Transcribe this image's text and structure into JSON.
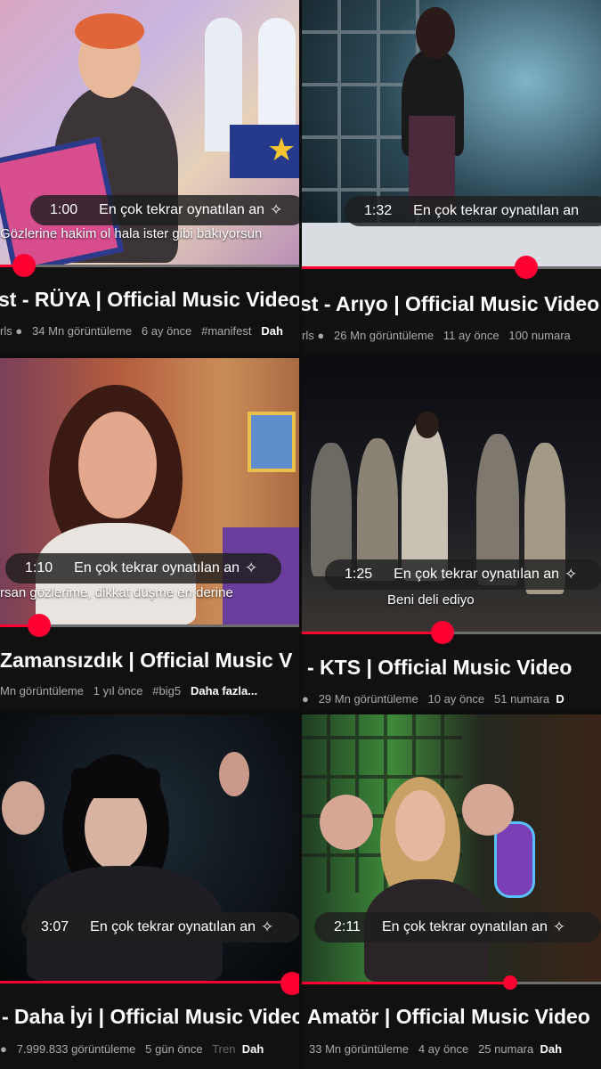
{
  "brand_color": "#ff0033",
  "sparkle_icon": "sparkle-icon",
  "videos": [
    {
      "time": "1:00",
      "moment_label": "En çok tekrar oynatılan an",
      "caption": "Gözlerine hakim ol hala ister gibi bakıyorsun",
      "title": "st - RÜYA | Official Music Video",
      "channel": "rls",
      "views": "34 Mn görüntüleme",
      "age": "6 ay önce",
      "extra": "#manifest",
      "more": "Dah",
      "progress": 0.08
    },
    {
      "time": "1:32",
      "moment_label": "En çok tekrar oynatılan an",
      "caption": "",
      "title": "st - Arıyo | Official Music Video",
      "channel": "rls",
      "views": "26 Mn görüntüleme",
      "age": "11 ay önce",
      "extra": "100 numara",
      "more": "",
      "progress": 0.75
    },
    {
      "time": "1:10",
      "moment_label": "En çok tekrar oynatılan an",
      "caption": "rsan gözlerime, dikkat düşme en derine",
      "title": "Zamansızdık | Official Music V",
      "channel": "",
      "views": "Mn görüntüleme",
      "age": "1 yıl önce",
      "extra": "#big5",
      "more": "Daha fazla...",
      "progress": 0.13
    },
    {
      "time": "1:25",
      "moment_label": "En çok tekrar oynatılan an",
      "caption": "Beni deli ediyo",
      "title": "- KTS | Official Music Video",
      "channel": "",
      "views": "29 Mn görüntüleme",
      "age": "10 ay önce",
      "extra": "51 numara",
      "more": "D",
      "progress": 0.47
    },
    {
      "time": "3:07",
      "moment_label": "En çok tekrar oynatılan an",
      "caption": "",
      "title": "- Daha İyi | Official Music Video",
      "channel": "",
      "views": "7.999.833 görüntüleme",
      "age": "5 gün önce",
      "extra": "Tren",
      "more": "Dah",
      "progress": 0.97
    },
    {
      "time": "2:11",
      "moment_label": "En çok tekrar oynatılan an",
      "caption": "",
      "title": "Amatör | Official Music Video",
      "channel": "",
      "views": "33 Mn görüntüleme",
      "age": "4 ay önce",
      "extra": "25 numara",
      "more": "Dah",
      "progress": 0.7
    }
  ]
}
